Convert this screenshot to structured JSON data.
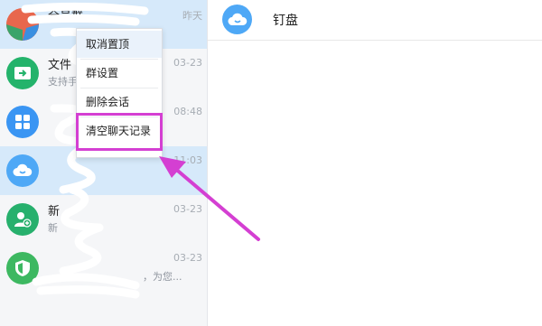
{
  "header": {
    "title": "钉盘",
    "avatar_icon": "cloud-disk-icon"
  },
  "conversations": [
    {
      "title": "全员群",
      "subtitle": "",
      "time": "昨天",
      "icon": "group-avatar-icon",
      "color": "#e8674d"
    },
    {
      "title": "文件",
      "subtitle": "支持手",
      "time": "03-23",
      "icon": "file-transfer-icon",
      "color": "#24b36b"
    },
    {
      "title": "",
      "subtitle": "",
      "time": "08:48",
      "icon": "apps-grid-icon",
      "color": "#3a95f3"
    },
    {
      "title": "",
      "subtitle": "",
      "time": "11:03",
      "icon": "cloud-disk-icon",
      "color": "#4ea8f6"
    },
    {
      "title": "新",
      "subtitle": "新",
      "time": "03-23",
      "icon": "add-friend-icon",
      "color": "#27b06d"
    },
    {
      "title": "",
      "subtitle": "，为您...",
      "time": "03-23",
      "icon": "security-shield-icon",
      "color": "#3db861"
    }
  ],
  "context_menu": {
    "items": [
      "取消置顶",
      "群设置",
      "删除会话",
      "清空聊天记录"
    ]
  },
  "colors": {
    "selected_row": "#d6e9fa",
    "annotation": "#d43fd2",
    "menu_hover": "#eaf2fb"
  }
}
